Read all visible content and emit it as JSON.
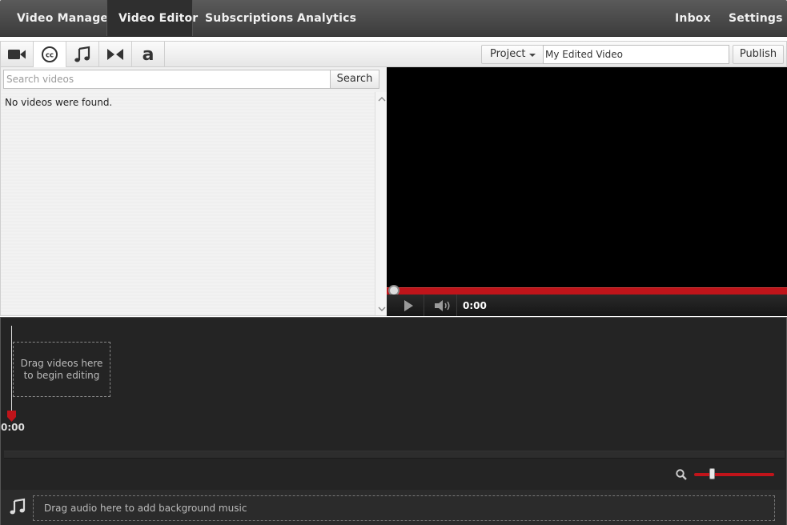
{
  "nav": {
    "video_manager": "Video Manager",
    "video_editor": "Video Editor",
    "subscriptions": "Subscriptions",
    "analytics": "Analytics",
    "inbox": "Inbox",
    "settings": "Settings"
  },
  "toolbar": {
    "tools": [
      "video-camera-icon",
      "closed-caption-icon",
      "music-note-icon",
      "transition-icon",
      "text-icon"
    ],
    "project_label": "Project",
    "title_value": "My Edited Video",
    "publish_label": "Publish"
  },
  "library": {
    "search_placeholder": "Search videos",
    "search_label": "Search",
    "empty_message": "No videos were found."
  },
  "player": {
    "time": "0:00",
    "progress_color": "#c0141a"
  },
  "timeline": {
    "playhead_time": "0:00",
    "drop_video_text": "Drag videos here to begin editing",
    "drop_audio_text": "Drag audio here to add background music",
    "zoom_level": 0.2
  }
}
